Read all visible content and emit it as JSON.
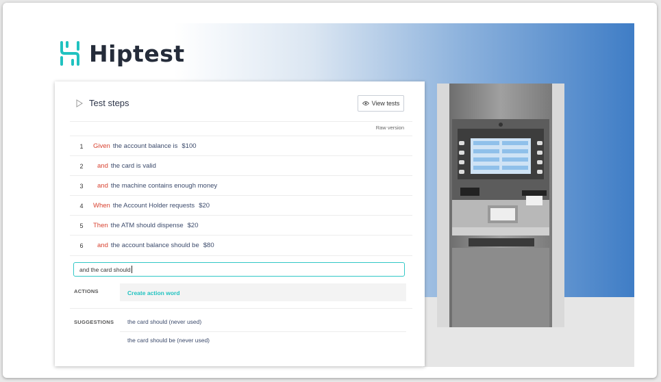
{
  "brand": {
    "name": "Hiptest",
    "accent": "#20c2c0",
    "keyword_color": "#d8412f"
  },
  "panel": {
    "title": "Test steps",
    "view_tests_label": "View tests",
    "raw_version_label": "Raw version"
  },
  "steps": [
    {
      "num": "1",
      "keyword": "Given",
      "text": "the account balance is",
      "value": "$100"
    },
    {
      "num": "2",
      "keyword": "and",
      "text": "the card is valid",
      "value": ""
    },
    {
      "num": "3",
      "keyword": "and",
      "text": "the machine contains enough money",
      "value": ""
    },
    {
      "num": "4",
      "keyword": "When",
      "text": "the Account Holder requests",
      "value": "$20"
    },
    {
      "num": "5",
      "keyword": "Then",
      "text": "the ATM should dispense",
      "value": "$20"
    },
    {
      "num": "6",
      "keyword": "and",
      "text": "the account balance should be",
      "value": "$80"
    }
  ],
  "step_input": {
    "value": "and the card should"
  },
  "actions": {
    "label": "ACTIONS",
    "create_label": "Create action word"
  },
  "suggestions": {
    "label": "SUGGESTIONS",
    "items": [
      "the card should (never used)",
      "the card should be (never used)"
    ]
  }
}
